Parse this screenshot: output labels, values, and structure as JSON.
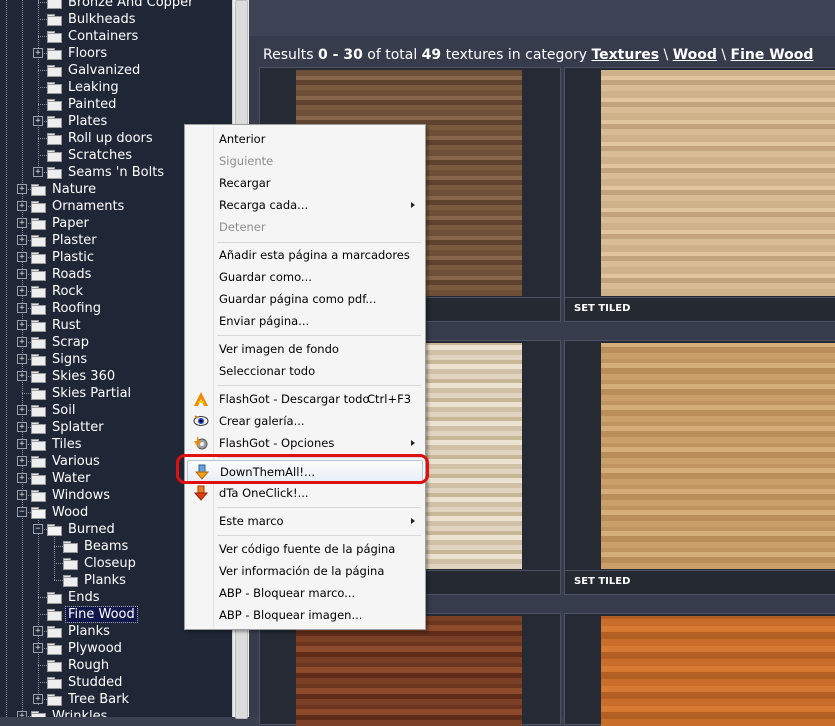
{
  "tree": {
    "items": [
      {
        "label": "Bronze And Copper",
        "depth": 2,
        "exp": false,
        "open": false,
        "selected": false
      },
      {
        "label": "Bulkheads",
        "depth": 2,
        "exp": false,
        "open": false,
        "selected": false
      },
      {
        "label": "Containers",
        "depth": 2,
        "exp": false,
        "open": false,
        "selected": false
      },
      {
        "label": "Floors",
        "depth": 2,
        "exp": true,
        "open": false,
        "selected": false
      },
      {
        "label": "Galvanized",
        "depth": 2,
        "exp": false,
        "open": false,
        "selected": false
      },
      {
        "label": "Leaking",
        "depth": 2,
        "exp": false,
        "open": false,
        "selected": false
      },
      {
        "label": "Painted",
        "depth": 2,
        "exp": false,
        "open": false,
        "selected": false
      },
      {
        "label": "Plates",
        "depth": 2,
        "exp": true,
        "open": false,
        "selected": false
      },
      {
        "label": "Roll up doors",
        "depth": 2,
        "exp": false,
        "open": false,
        "selected": false
      },
      {
        "label": "Scratches",
        "depth": 2,
        "exp": false,
        "open": false,
        "selected": false
      },
      {
        "label": "Seams 'n Bolts",
        "depth": 2,
        "exp": true,
        "open": false,
        "selected": false
      },
      {
        "label": "Nature",
        "depth": 1,
        "exp": true,
        "open": false,
        "selected": false
      },
      {
        "label": "Ornaments",
        "depth": 1,
        "exp": true,
        "open": false,
        "selected": false
      },
      {
        "label": "Paper",
        "depth": 1,
        "exp": true,
        "open": false,
        "selected": false
      },
      {
        "label": "Plaster",
        "depth": 1,
        "exp": true,
        "open": false,
        "selected": false
      },
      {
        "label": "Plastic",
        "depth": 1,
        "exp": true,
        "open": false,
        "selected": false
      },
      {
        "label": "Roads",
        "depth": 1,
        "exp": true,
        "open": false,
        "selected": false
      },
      {
        "label": "Rock",
        "depth": 1,
        "exp": true,
        "open": false,
        "selected": false
      },
      {
        "label": "Roofing",
        "depth": 1,
        "exp": true,
        "open": false,
        "selected": false
      },
      {
        "label": "Rust",
        "depth": 1,
        "exp": true,
        "open": false,
        "selected": false
      },
      {
        "label": "Scrap",
        "depth": 1,
        "exp": true,
        "open": false,
        "selected": false
      },
      {
        "label": "Signs",
        "depth": 1,
        "exp": true,
        "open": false,
        "selected": false
      },
      {
        "label": "Skies 360",
        "depth": 1,
        "exp": true,
        "open": false,
        "selected": false
      },
      {
        "label": "Skies Partial",
        "depth": 1,
        "exp": false,
        "open": false,
        "selected": false
      },
      {
        "label": "Soil",
        "depth": 1,
        "exp": true,
        "open": false,
        "selected": false
      },
      {
        "label": "Splatter",
        "depth": 1,
        "exp": true,
        "open": false,
        "selected": false
      },
      {
        "label": "Tiles",
        "depth": 1,
        "exp": true,
        "open": false,
        "selected": false
      },
      {
        "label": "Various",
        "depth": 1,
        "exp": true,
        "open": false,
        "selected": false
      },
      {
        "label": "Water",
        "depth": 1,
        "exp": true,
        "open": false,
        "selected": false
      },
      {
        "label": "Windows",
        "depth": 1,
        "exp": true,
        "open": false,
        "selected": false
      },
      {
        "label": "Wood",
        "depth": 1,
        "exp": true,
        "open": true,
        "selected": false
      },
      {
        "label": "Burned",
        "depth": 2,
        "exp": true,
        "open": true,
        "selected": false
      },
      {
        "label": "Beams",
        "depth": 3,
        "exp": false,
        "open": false,
        "selected": false
      },
      {
        "label": "Closeup",
        "depth": 3,
        "exp": false,
        "open": false,
        "selected": false
      },
      {
        "label": "Planks",
        "depth": 3,
        "exp": false,
        "open": false,
        "selected": false
      },
      {
        "label": "Ends",
        "depth": 2,
        "exp": false,
        "open": false,
        "selected": false
      },
      {
        "label": "Fine Wood",
        "depth": 2,
        "exp": false,
        "open": false,
        "selected": true
      },
      {
        "label": "Planks",
        "depth": 2,
        "exp": true,
        "open": false,
        "selected": false
      },
      {
        "label": "Plywood",
        "depth": 2,
        "exp": true,
        "open": false,
        "selected": false
      },
      {
        "label": "Rough",
        "depth": 2,
        "exp": false,
        "open": false,
        "selected": false
      },
      {
        "label": "Studded",
        "depth": 2,
        "exp": false,
        "open": false,
        "selected": false
      },
      {
        "label": "Tree Bark",
        "depth": 2,
        "exp": true,
        "open": false,
        "selected": false
      },
      {
        "label": "Wrinkles",
        "depth": 1,
        "exp": true,
        "open": false,
        "selected": false
      }
    ]
  },
  "results": {
    "prefix": "Results ",
    "from": "0",
    "dash": " - ",
    "to": "30",
    "of": " of total ",
    "total": "49",
    "suffix": " textures in category ",
    "crumb1": "Textures",
    "sep": " \\ ",
    "crumb2": "Wood",
    "crumb3": "Fine Wood"
  },
  "cards": {
    "set_tiled": "SET TILED"
  },
  "menu": {
    "anterior": "Anterior",
    "siguiente": "Siguiente",
    "recargar": "Recargar",
    "recarga_cada": "Recarga cada...",
    "detener": "Detener",
    "marcadores": "Añadir esta página a marcadores",
    "guardar_como": "Guardar como...",
    "guardar_pdf": "Guardar página como pdf...",
    "enviar": "Enviar página...",
    "ver_fondo": "Ver imagen de fondo",
    "seleccionar": "Seleccionar todo",
    "flashgot_todo": "FlashGot - Descargar todo",
    "flashgot_shortcut": "Ctrl+F3",
    "crear_galeria": "Crear galería...",
    "flashgot_opciones": "FlashGot - Opciones",
    "downthemall": "DownThemAll!...",
    "oneclick": "dTa OneClick!...",
    "este_marco": "Este marco",
    "ver_codigo": "Ver código fuente de la página",
    "ver_info": "Ver información de la página",
    "abp_marco": "ABP - Bloquear marco...",
    "abp_imagen": "ABP - Bloquear imagen..."
  },
  "colors": {
    "highlight": "#e01010",
    "tree_bg": "#1f2636",
    "selected_bg": "#11174a"
  }
}
